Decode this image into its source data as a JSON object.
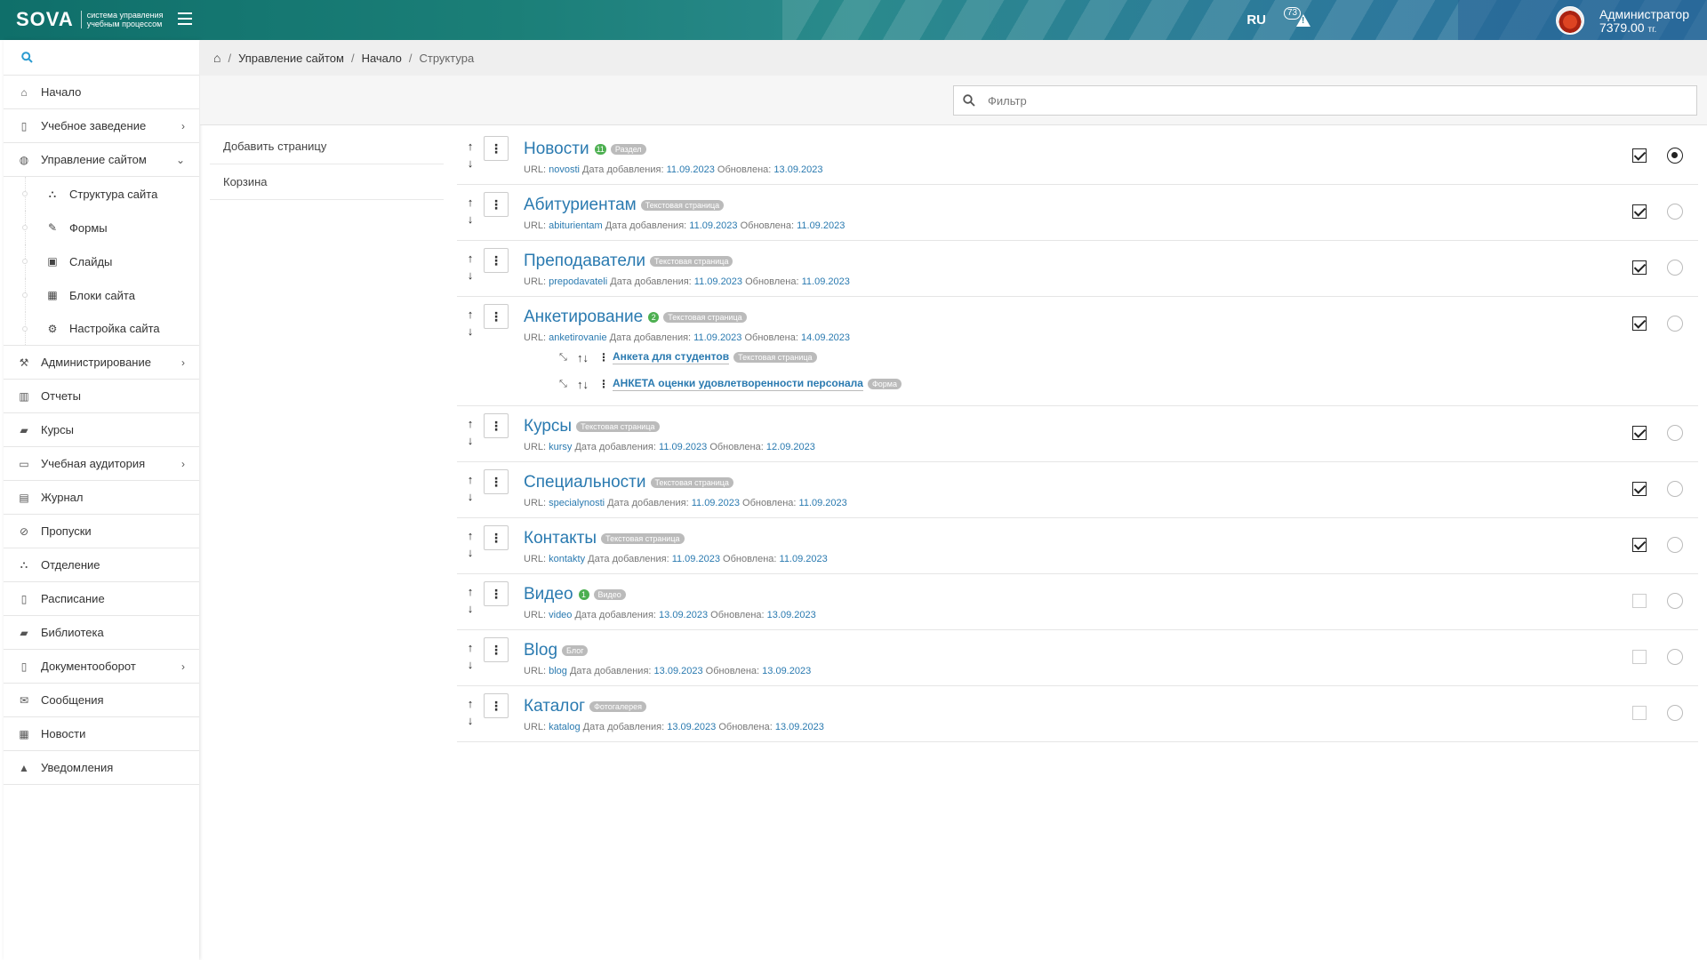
{
  "header": {
    "logo_word": "SOVA",
    "logo_sub": "система управления учебным процессом",
    "lang": "RU",
    "alert_count": "73",
    "user_name": "Администратор",
    "user_balance": "7379.00",
    "user_currency": "тг."
  },
  "sidebar": {
    "items": [
      {
        "label": "Начало",
        "icon": "home-icon"
      },
      {
        "label": "Учебное заведение",
        "icon": "building-icon"
      },
      {
        "label": "Управление сайтом",
        "icon": "globe-icon"
      },
      {
        "label": "Администрирование",
        "icon": "gavel-icon"
      },
      {
        "label": "Отчеты",
        "icon": "bar-chart-icon"
      },
      {
        "label": "Курсы",
        "icon": "book-icon"
      },
      {
        "label": "Учебная аудитория",
        "icon": "monitor-icon"
      },
      {
        "label": "Журнал",
        "icon": "table-icon"
      },
      {
        "label": "Пропуски",
        "icon": "ban-icon"
      },
      {
        "label": "Отделение",
        "icon": "sitemap-icon"
      },
      {
        "label": "Расписание",
        "icon": "calendar-icon"
      },
      {
        "label": "Библиотека",
        "icon": "books-icon"
      },
      {
        "label": "Документооборот",
        "icon": "document-icon"
      },
      {
        "label": "Сообщения",
        "icon": "envelope-icon"
      },
      {
        "label": "Новости",
        "icon": "newspaper-icon"
      },
      {
        "label": "Уведомления",
        "icon": "warning-icon"
      }
    ],
    "sub_items": [
      {
        "label": "Структура сайта",
        "icon": "sitemap-icon"
      },
      {
        "label": "Формы",
        "icon": "pencil-icon"
      },
      {
        "label": "Слайды",
        "icon": "slides-icon"
      },
      {
        "label": "Блоки сайта",
        "icon": "grid-icon"
      },
      {
        "label": "Настройка сайта",
        "icon": "cogs-icon"
      }
    ]
  },
  "breadcrumb": {
    "items": [
      "Управление сайтом",
      "Начало",
      "Структура"
    ]
  },
  "filter": {
    "placeholder": "Фильтр",
    "value": ""
  },
  "actions": {
    "add_page": "Добавить страницу",
    "trash": "Корзина"
  },
  "meta_labels": {
    "url": "URL:",
    "added": "Дата добавления:",
    "updated": "Обновлена:"
  },
  "pages": [
    {
      "title": "Новости",
      "count": "11",
      "type": "Раздел",
      "url": "novosti",
      "added": "11.09.2023",
      "updated": "13.09.2023",
      "checked": true,
      "radio": true
    },
    {
      "title": "Абитуриентам",
      "count": "",
      "type": "Текстовая страница",
      "url": "abiturientam",
      "added": "11.09.2023",
      "updated": "11.09.2023",
      "checked": true,
      "radio": false
    },
    {
      "title": "Преподаватели",
      "count": "",
      "type": "Текстовая страница",
      "url": "prepodavateli",
      "added": "11.09.2023",
      "updated": "11.09.2023",
      "checked": true,
      "radio": false
    },
    {
      "title": "Анкетирование",
      "count": "2",
      "type": "Текстовая страница",
      "url": "anketirovanie",
      "added": "11.09.2023",
      "updated": "14.09.2023",
      "checked": true,
      "radio": false,
      "children": [
        {
          "title": "Анкета для студентов",
          "type": "Текстовая страница"
        },
        {
          "title": "АНКЕТА оценки удовлетворенности персонала",
          "type": "Форма"
        }
      ]
    },
    {
      "title": "Курсы",
      "count": "",
      "type": "Текстовая страница",
      "url": "kursy",
      "added": "11.09.2023",
      "updated": "12.09.2023",
      "checked": true,
      "radio": false
    },
    {
      "title": "Специальности",
      "count": "",
      "type": "Текстовая страница",
      "url": "specialynosti",
      "added": "11.09.2023",
      "updated": "11.09.2023",
      "checked": true,
      "radio": false
    },
    {
      "title": "Контакты",
      "count": "",
      "type": "Текстовая страница",
      "url": "kontakty",
      "added": "11.09.2023",
      "updated": "11.09.2023",
      "checked": true,
      "radio": false
    },
    {
      "title": "Видео",
      "count": "1",
      "type": "Видео",
      "url": "video",
      "added": "13.09.2023",
      "updated": "13.09.2023",
      "checked": false,
      "radio": false
    },
    {
      "title": "Blog",
      "count": "",
      "type": "Блог",
      "url": "blog",
      "added": "13.09.2023",
      "updated": "13.09.2023",
      "checked": false,
      "radio": false
    },
    {
      "title": "Каталог",
      "count": "",
      "type": "Фотогалерея",
      "url": "katalog",
      "added": "13.09.2023",
      "updated": "13.09.2023",
      "checked": false,
      "radio": false
    }
  ]
}
